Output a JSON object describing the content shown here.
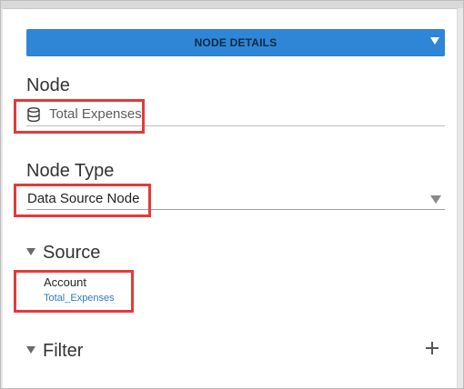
{
  "colors": {
    "accent": "#2f86d6",
    "highlight": "#e23b3b",
    "link": "#2f78c4"
  },
  "header": {
    "node_details_label": "NODE DETAILS",
    "dropdown_icon": "caret-down-icon"
  },
  "node": {
    "section_label": "Node",
    "icon": "database-icon",
    "value": "Total Expenses"
  },
  "node_type": {
    "section_label": "Node Type",
    "selected_value": "Data Source Node",
    "dropdown_icon": "caret-down-icon"
  },
  "source": {
    "section_label": "Source",
    "collapse_icon": "caret-down-icon",
    "account_label": "Account",
    "account_link": "Total_Expenses"
  },
  "filter": {
    "section_label": "Filter",
    "collapse_icon": "caret-down-icon",
    "add_icon": "plus-icon"
  }
}
